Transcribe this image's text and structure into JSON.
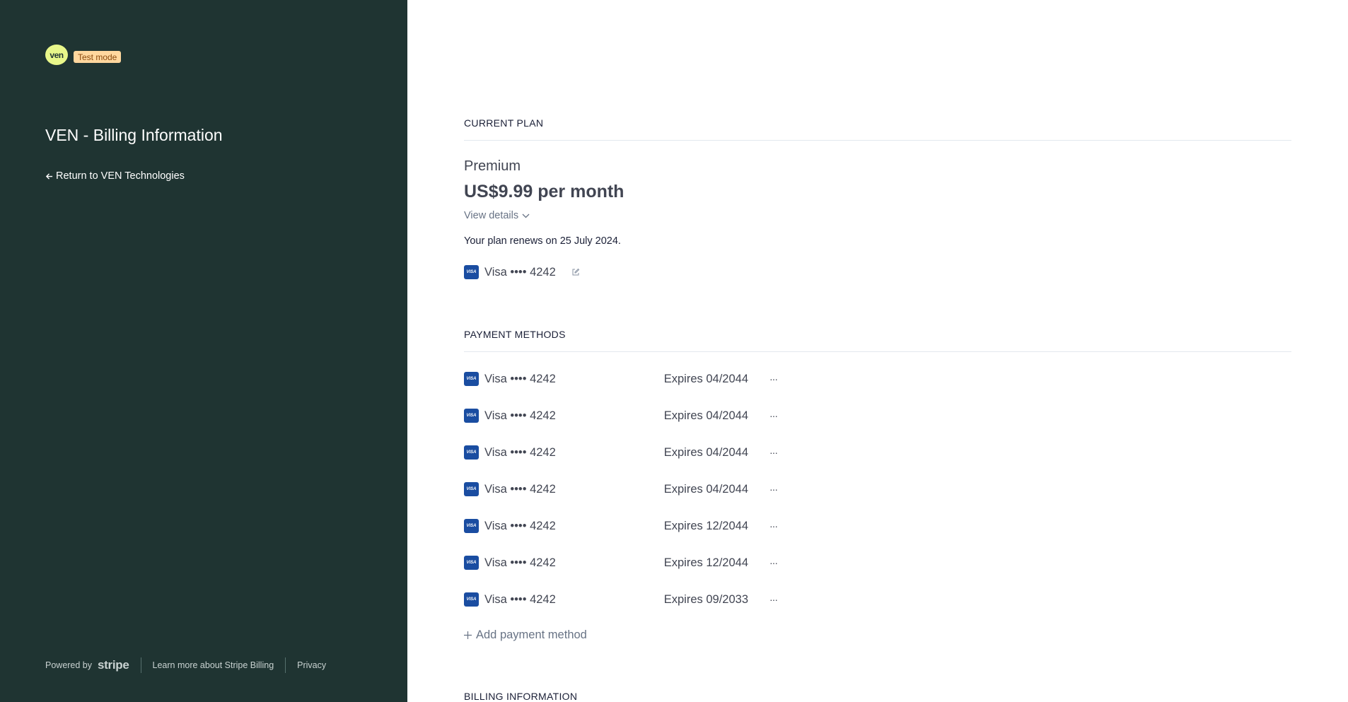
{
  "sidebar": {
    "logo_text": "ven",
    "test_mode": "Test mode",
    "title": "VEN - Billing Information",
    "return_link": "Return to VEN Technologies",
    "footer": {
      "powered_by": "Powered by",
      "stripe": "stripe",
      "learn_more": "Learn more about Stripe Billing",
      "privacy": "Privacy"
    }
  },
  "current_plan": {
    "header": "CURRENT PLAN",
    "name": "Premium",
    "price": "US$9.99 per month",
    "view_details": "View details",
    "renews": "Your plan renews on 25 July 2024.",
    "card_label": "Visa •••• 4242",
    "card_icon": "VISA"
  },
  "payment_methods": {
    "header": "PAYMENT METHODS",
    "items": [
      {
        "label": "Visa •••• 4242",
        "expires": "Expires 04/2044",
        "icon": "VISA",
        "more": "···"
      },
      {
        "label": "Visa •••• 4242",
        "expires": "Expires 04/2044",
        "icon": "VISA",
        "more": "···"
      },
      {
        "label": "Visa •••• 4242",
        "expires": "Expires 04/2044",
        "icon": "VISA",
        "more": "···"
      },
      {
        "label": "Visa •••• 4242",
        "expires": "Expires 04/2044",
        "icon": "VISA",
        "more": "···"
      },
      {
        "label": "Visa •••• 4242",
        "expires": "Expires 12/2044",
        "icon": "VISA",
        "more": "···"
      },
      {
        "label": "Visa •••• 4242",
        "expires": "Expires 12/2044",
        "icon": "VISA",
        "more": "···"
      },
      {
        "label": "Visa •••• 4242",
        "expires": "Expires 09/2033",
        "icon": "VISA",
        "more": "···"
      }
    ],
    "add_label": "Add payment method"
  },
  "billing_information": {
    "header": "BILLING INFORMATION"
  },
  "colors": {
    "sidebar_bg": "#1f3432",
    "logo_bg": "#e8f78a",
    "badge_bg": "#ffd79e",
    "visa_blue": "#1a4da1"
  }
}
